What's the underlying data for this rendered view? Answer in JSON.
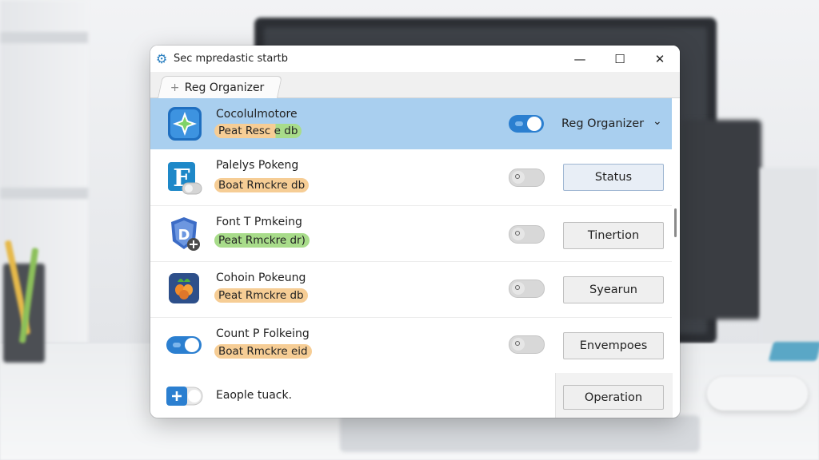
{
  "window": {
    "title": "Sec mpredastic startb",
    "controls": {
      "minimize": "—",
      "maximize": "☐",
      "close": "✕"
    }
  },
  "tab": {
    "plus": "+",
    "label": "Reg Organizer"
  },
  "rows": [
    {
      "title": "Cocolulmotore",
      "badge": "Peat Resc e db",
      "right_label": "Reg Organizer",
      "chevron": "⌄"
    },
    {
      "title": "Palelys Pokeng",
      "badge": "Boat Rmckre db",
      "button": "Status"
    },
    {
      "title": "Font T Pmkeing",
      "badge": "Peat Rmckre dr)",
      "button": "Tinertion"
    },
    {
      "title": "Cohoin Pokeung",
      "badge": "Peat Rmckre db",
      "button": "Syearun"
    },
    {
      "title": "Count P Folkeing",
      "badge": "Boat Rmckre eid",
      "button": "Envempoes"
    },
    {
      "title": "Eaople tuack.",
      "button": "Operation"
    }
  ],
  "colors": {
    "selection": "#a9cfef",
    "toggle_on": "#2b7fd0",
    "badge_orange": "#f6cd95",
    "badge_green": "#a8dc8a"
  },
  "icons": {
    "app": "gear-icon",
    "row1": "compass-star-icon",
    "row2": "letter-f-icon",
    "row3": "shield-plus-icon",
    "row4": "carrot-icon",
    "row6": "plus-icon"
  }
}
